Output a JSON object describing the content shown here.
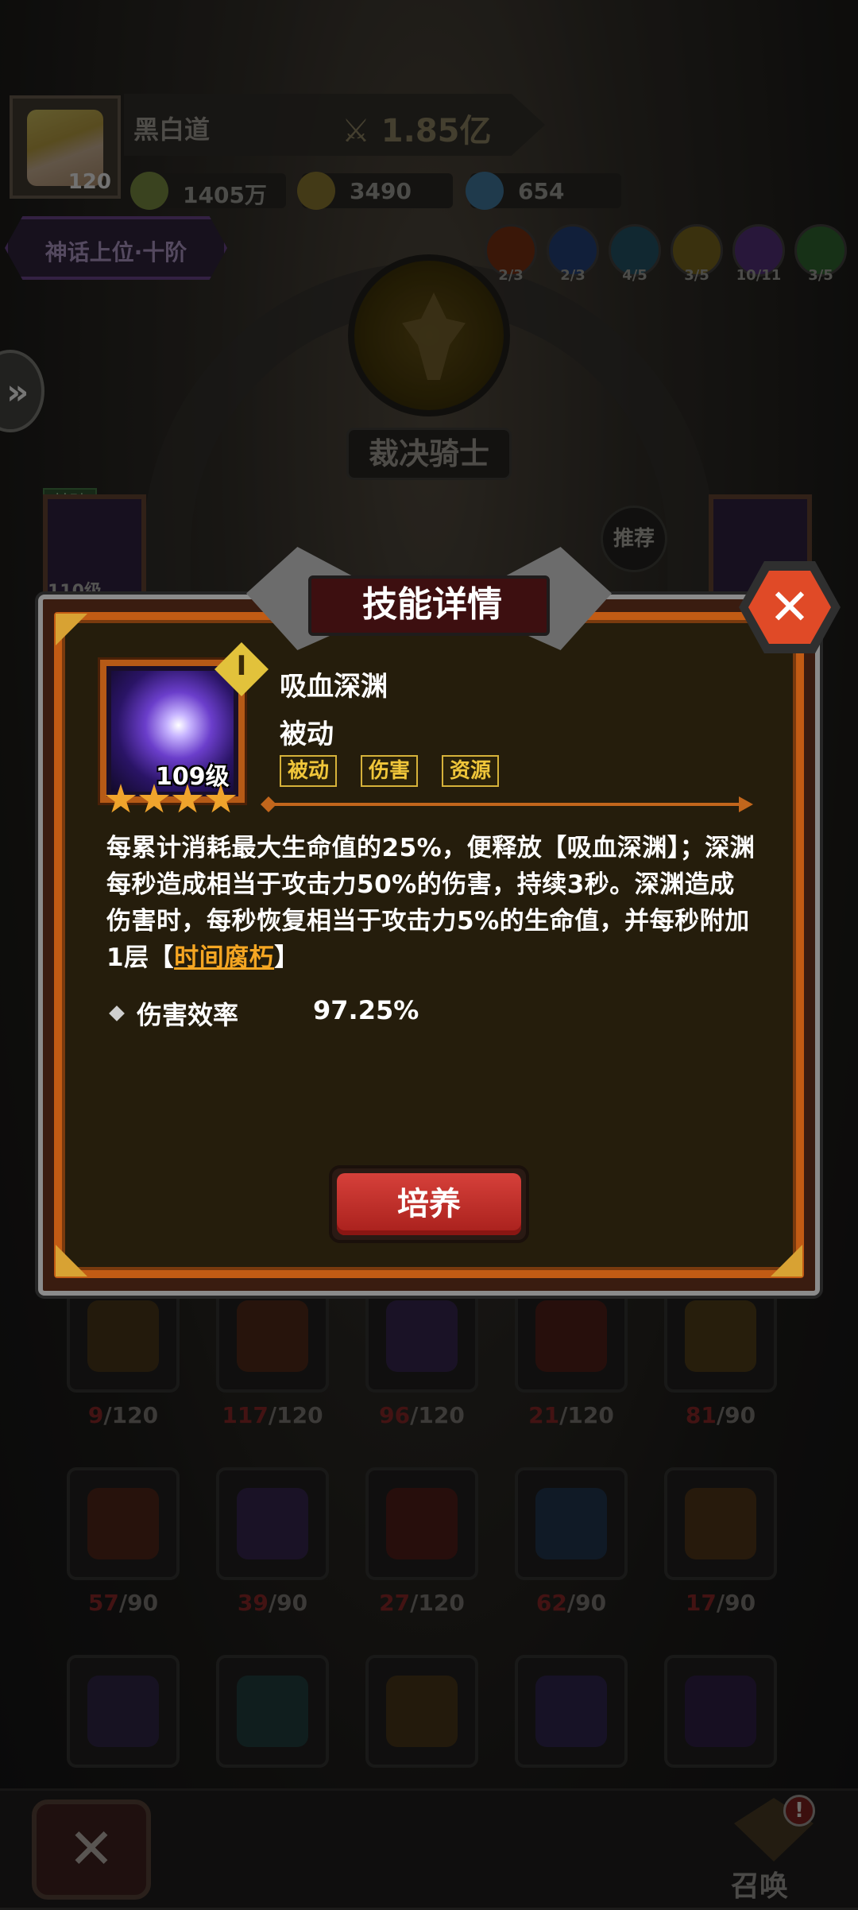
{
  "player": {
    "name": "黑白道",
    "level": "120",
    "power": "1.85亿",
    "resources": [
      {
        "icon": "gold-coin-icon",
        "value": "1405万",
        "color": "#6b7a3a"
      },
      {
        "icon": "energy-coin-icon",
        "value": "3490",
        "color": "#7a6a2a"
      },
      {
        "icon": "gem-icon",
        "value": "654",
        "color": "#3a6a8a"
      }
    ],
    "rank": "神话上位·十阶"
  },
  "elements": [
    {
      "icon": "fire-element-icon",
      "count": "2/3",
      "color": "#6b2a10"
    },
    {
      "icon": "wind-element-icon",
      "count": "2/3",
      "color": "#1f3a6b"
    },
    {
      "icon": "ice-element-icon",
      "count": "4/5",
      "color": "#1f4a5a"
    },
    {
      "icon": "light-element-icon",
      "count": "3/5",
      "color": "#6b5a1a"
    },
    {
      "icon": "moon-element-icon",
      "count": "10/11",
      "color": "#4a2a6b"
    },
    {
      "icon": "nature-element-icon",
      "count": "3/5",
      "color": "#2a5a2a"
    }
  ],
  "hero_class": "裁决骑士",
  "basic_tag": "基础",
  "side_card_level": "110级",
  "recommend_label": "推荐",
  "grid": [
    {
      "cur": "9",
      "max": "/120",
      "color": "#6b4a12"
    },
    {
      "cur": "117",
      "max": "/120",
      "color": "#7a3012"
    },
    {
      "cur": "96",
      "max": "/120",
      "color": "#4a2a7a"
    },
    {
      "cur": "21",
      "max": "/120",
      "color": "#7a2012"
    },
    {
      "cur": "81",
      "max": "/90",
      "color": "#7a5a12"
    },
    {
      "cur": "57",
      "max": "/90",
      "color": "#7a2a12"
    },
    {
      "cur": "39",
      "max": "/90",
      "color": "#4a2a7a"
    },
    {
      "cur": "27",
      "max": "/120",
      "color": "#7a1a12"
    },
    {
      "cur": "62",
      "max": "/90",
      "color": "#1f4a7a"
    },
    {
      "cur": "17",
      "max": "/90",
      "color": "#7a4a12"
    },
    {
      "cur": "",
      "max": "",
      "color": "#3a2a6b"
    },
    {
      "cur": "",
      "max": "",
      "color": "#1f5a5a"
    },
    {
      "cur": "",
      "max": "",
      "color": "#6b4a12"
    },
    {
      "cur": "",
      "max": "",
      "color": "#3a2a7a"
    },
    {
      "cur": "",
      "max": "",
      "color": "#3a1f6b"
    }
  ],
  "summon_label": "召唤",
  "summon_alert": "!",
  "dialog": {
    "title": "技能详情",
    "close_glyph": "✕",
    "tier": "I",
    "skill_level": "109级",
    "stars": 4,
    "skill_name": "吸血深渊",
    "skill_type": "被动",
    "tags": [
      "被动",
      "伤害",
      "资源"
    ],
    "description_before": "每累计消耗最大生命值的25%，便释放【吸血深渊】；深渊每秒造成相当于攻击力50%的伤害，持续3秒。深渊造成伤害时，每秒恢复相当于攻击力5%的生命值，并每秒附加1层【",
    "description_link": "时间腐朽",
    "description_after": "】",
    "stat_label": "伤害效率",
    "stat_value": "97.25%",
    "train_button": "培养"
  }
}
